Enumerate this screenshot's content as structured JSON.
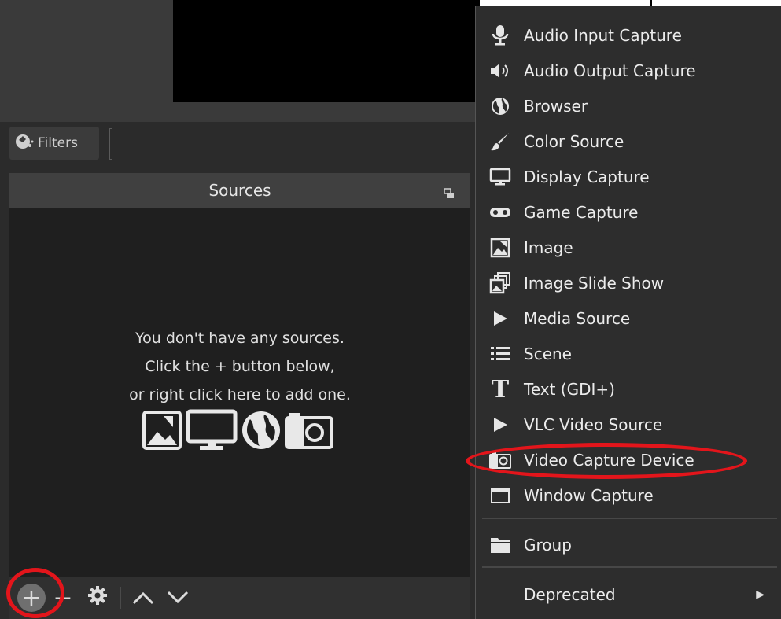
{
  "filters": {
    "label": "Filters"
  },
  "sources": {
    "title": "Sources",
    "empty_lines": [
      "You don't have any sources.",
      "Click the + button below,",
      "or right click here to add one."
    ],
    "toolbar": {
      "add": "+",
      "remove": "−",
      "settings": "⚙",
      "up": "^",
      "down": "v"
    }
  },
  "menu": {
    "items": [
      {
        "label": "Audio Input Capture",
        "icon": "microphone-icon"
      },
      {
        "label": "Audio Output Capture",
        "icon": "speaker-icon"
      },
      {
        "label": "Browser",
        "icon": "globe-icon"
      },
      {
        "label": "Color Source",
        "icon": "paintbrush-icon"
      },
      {
        "label": "Display Capture",
        "icon": "monitor-icon"
      },
      {
        "label": "Game Capture",
        "icon": "gamepad-icon"
      },
      {
        "label": "Image",
        "icon": "image-icon"
      },
      {
        "label": "Image Slide Show",
        "icon": "slideshow-icon"
      },
      {
        "label": "Media Source",
        "icon": "play-icon"
      },
      {
        "label": "Scene",
        "icon": "list-icon"
      },
      {
        "label": "Text (GDI+)",
        "icon": "text-icon"
      },
      {
        "label": "VLC Video Source",
        "icon": "play-icon"
      },
      {
        "label": "Video Capture Device",
        "icon": "camera-icon"
      },
      {
        "label": "Window Capture",
        "icon": "window-icon"
      },
      {
        "label": "Group",
        "icon": "folder-icon"
      },
      {
        "label": "Deprecated",
        "icon": ""
      }
    ]
  },
  "colors": {
    "highlight": "#e3151b",
    "menu_bg": "#2d2d2d",
    "dock_bg": "#1f1f1f"
  }
}
